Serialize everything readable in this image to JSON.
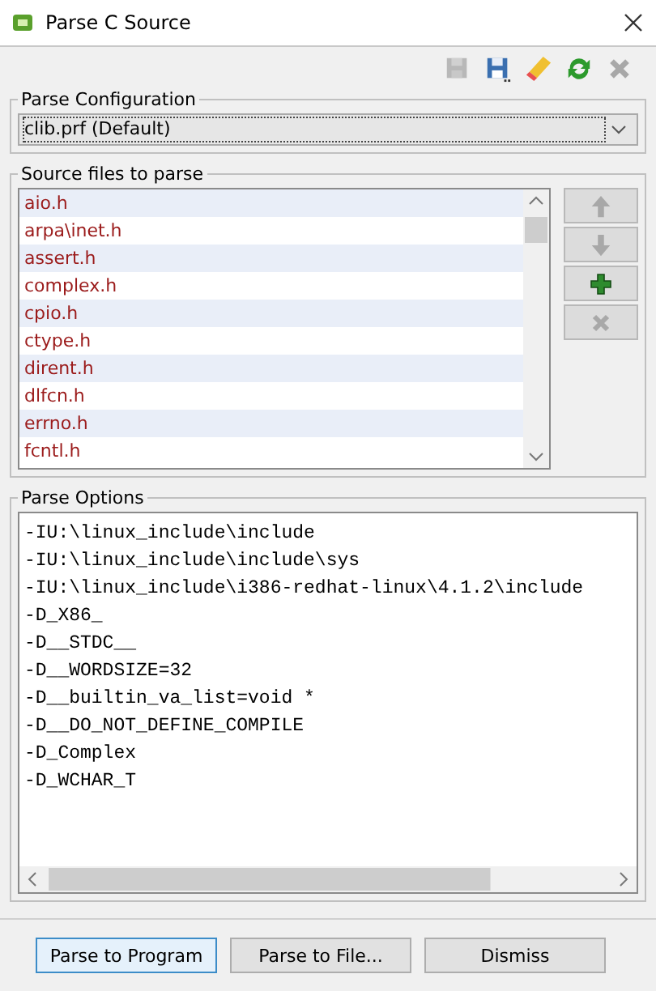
{
  "window": {
    "title": "Parse C Source"
  },
  "toolbar": [
    {
      "kind": "save",
      "disabled": true
    },
    {
      "kind": "save-as",
      "disabled": false
    },
    {
      "kind": "eraser",
      "disabled": false
    },
    {
      "kind": "refresh",
      "disabled": false
    },
    {
      "kind": "delete",
      "disabled": true
    }
  ],
  "parse_configuration": {
    "label": "Parse Configuration",
    "value": "clib.prf (Default)"
  },
  "source_files": {
    "label": "Source files to parse",
    "items": [
      "aio.h",
      "arpa\\inet.h",
      "assert.h",
      "complex.h",
      "cpio.h",
      "ctype.h",
      "dirent.h",
      "dlfcn.h",
      "errno.h",
      "fcntl.h"
    ],
    "side_buttons": [
      {
        "kind": "up",
        "disabled": true
      },
      {
        "kind": "down",
        "disabled": true
      },
      {
        "kind": "add",
        "disabled": false
      },
      {
        "kind": "remove",
        "disabled": true
      }
    ]
  },
  "parse_options": {
    "label": "Parse Options",
    "lines": [
      "-IU:\\linux_include\\include",
      "-IU:\\linux_include\\include\\sys",
      "-IU:\\linux_include\\i386-redhat-linux\\4.1.2\\include",
      "-D_X86_",
      "-D__STDC__",
      "-D__WORDSIZE=32",
      "-D__builtin_va_list=void *",
      "-D__DO_NOT_DEFINE_COMPILE",
      "-D_Complex",
      "-D_WCHAR_T"
    ]
  },
  "buttons": [
    {
      "label": "Parse to Program",
      "default": true
    },
    {
      "label": "Parse to File...",
      "default": false
    },
    {
      "label": "Dismiss",
      "default": false
    }
  ]
}
